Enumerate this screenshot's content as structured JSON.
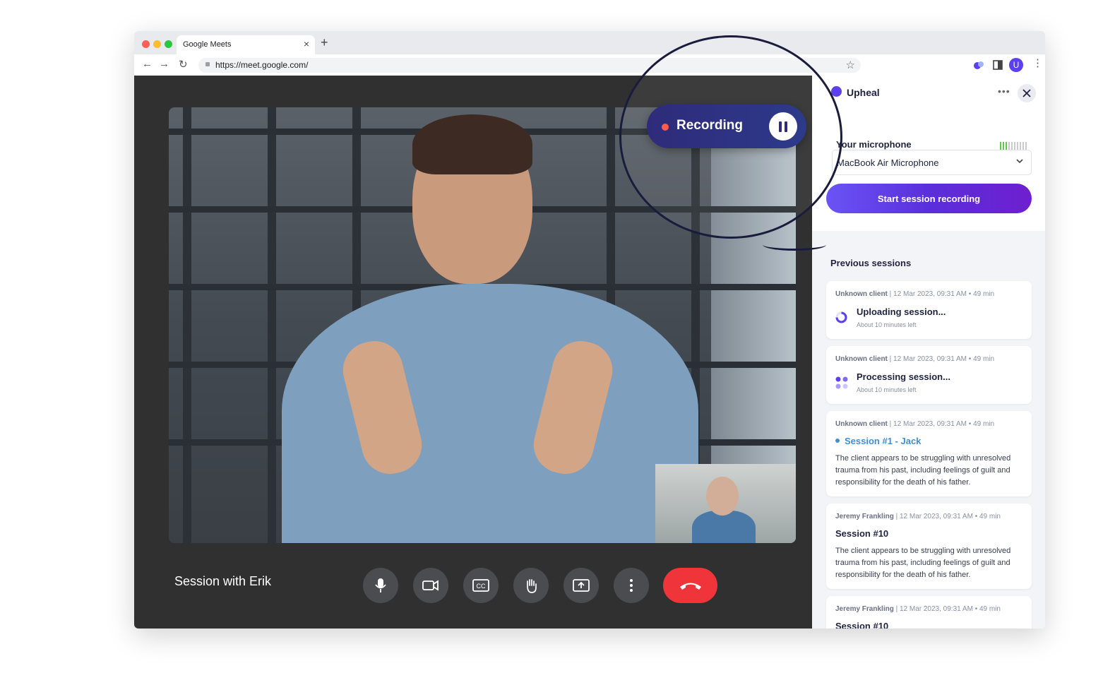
{
  "browser": {
    "tab_title": "Google Meets",
    "url": "https://meet.google.com/",
    "profile_initial": "U"
  },
  "meeting": {
    "title": "Session with Erik",
    "controls": [
      "microphone",
      "camera",
      "captions",
      "raise-hand",
      "present",
      "more",
      "end-call"
    ]
  },
  "recording_badge": {
    "label": "Recording"
  },
  "upheal": {
    "name": "Upheal",
    "mic_label": "Your microphone",
    "mic_device": "MacBook Air Microphone",
    "mic_level_active_bars": 3,
    "mic_level_total_bars": 10,
    "start_button": "Start session recording",
    "previous_title": "Previous sessions",
    "sessions": [
      {
        "client": "Unknown client",
        "meta": " | 12 Mar 2023, 09:31 AM • 49 min",
        "title": "Uploading session...",
        "subtitle": "About 10 minutes left"
      },
      {
        "client": "Unknown client",
        "meta": " | 12 Mar 2023, 09:31 AM • 49 min",
        "title": "Processing session...",
        "subtitle": "About 10 minutes left"
      },
      {
        "client": "Unknown client",
        "meta": " | 12 Mar 2023, 09:31 AM • 49 min",
        "title": "Session #1 - Jack",
        "summary": "The client appears to be struggling with unresolved trauma from his past, including feelings of guilt and responsibility for the death of his father."
      },
      {
        "client": "Jeremy Frankling",
        "meta": " | 12 Mar 2023, 09:31 AM • 49 min",
        "title": "Session #10",
        "summary": "The client appears to be struggling with unresolved trauma from his past, including feelings of guilt and responsibility for the death of his father."
      },
      {
        "client": "Jeremy Frankling",
        "meta": " | 12 Mar 2023, 09:31 AM • 49 min",
        "title": "Session #10"
      }
    ]
  },
  "colors": {
    "accent": "#5b3ff0",
    "link": "#3f8fd6",
    "end_call": "#f0353a",
    "recording_dot": "#ff5b4a"
  }
}
